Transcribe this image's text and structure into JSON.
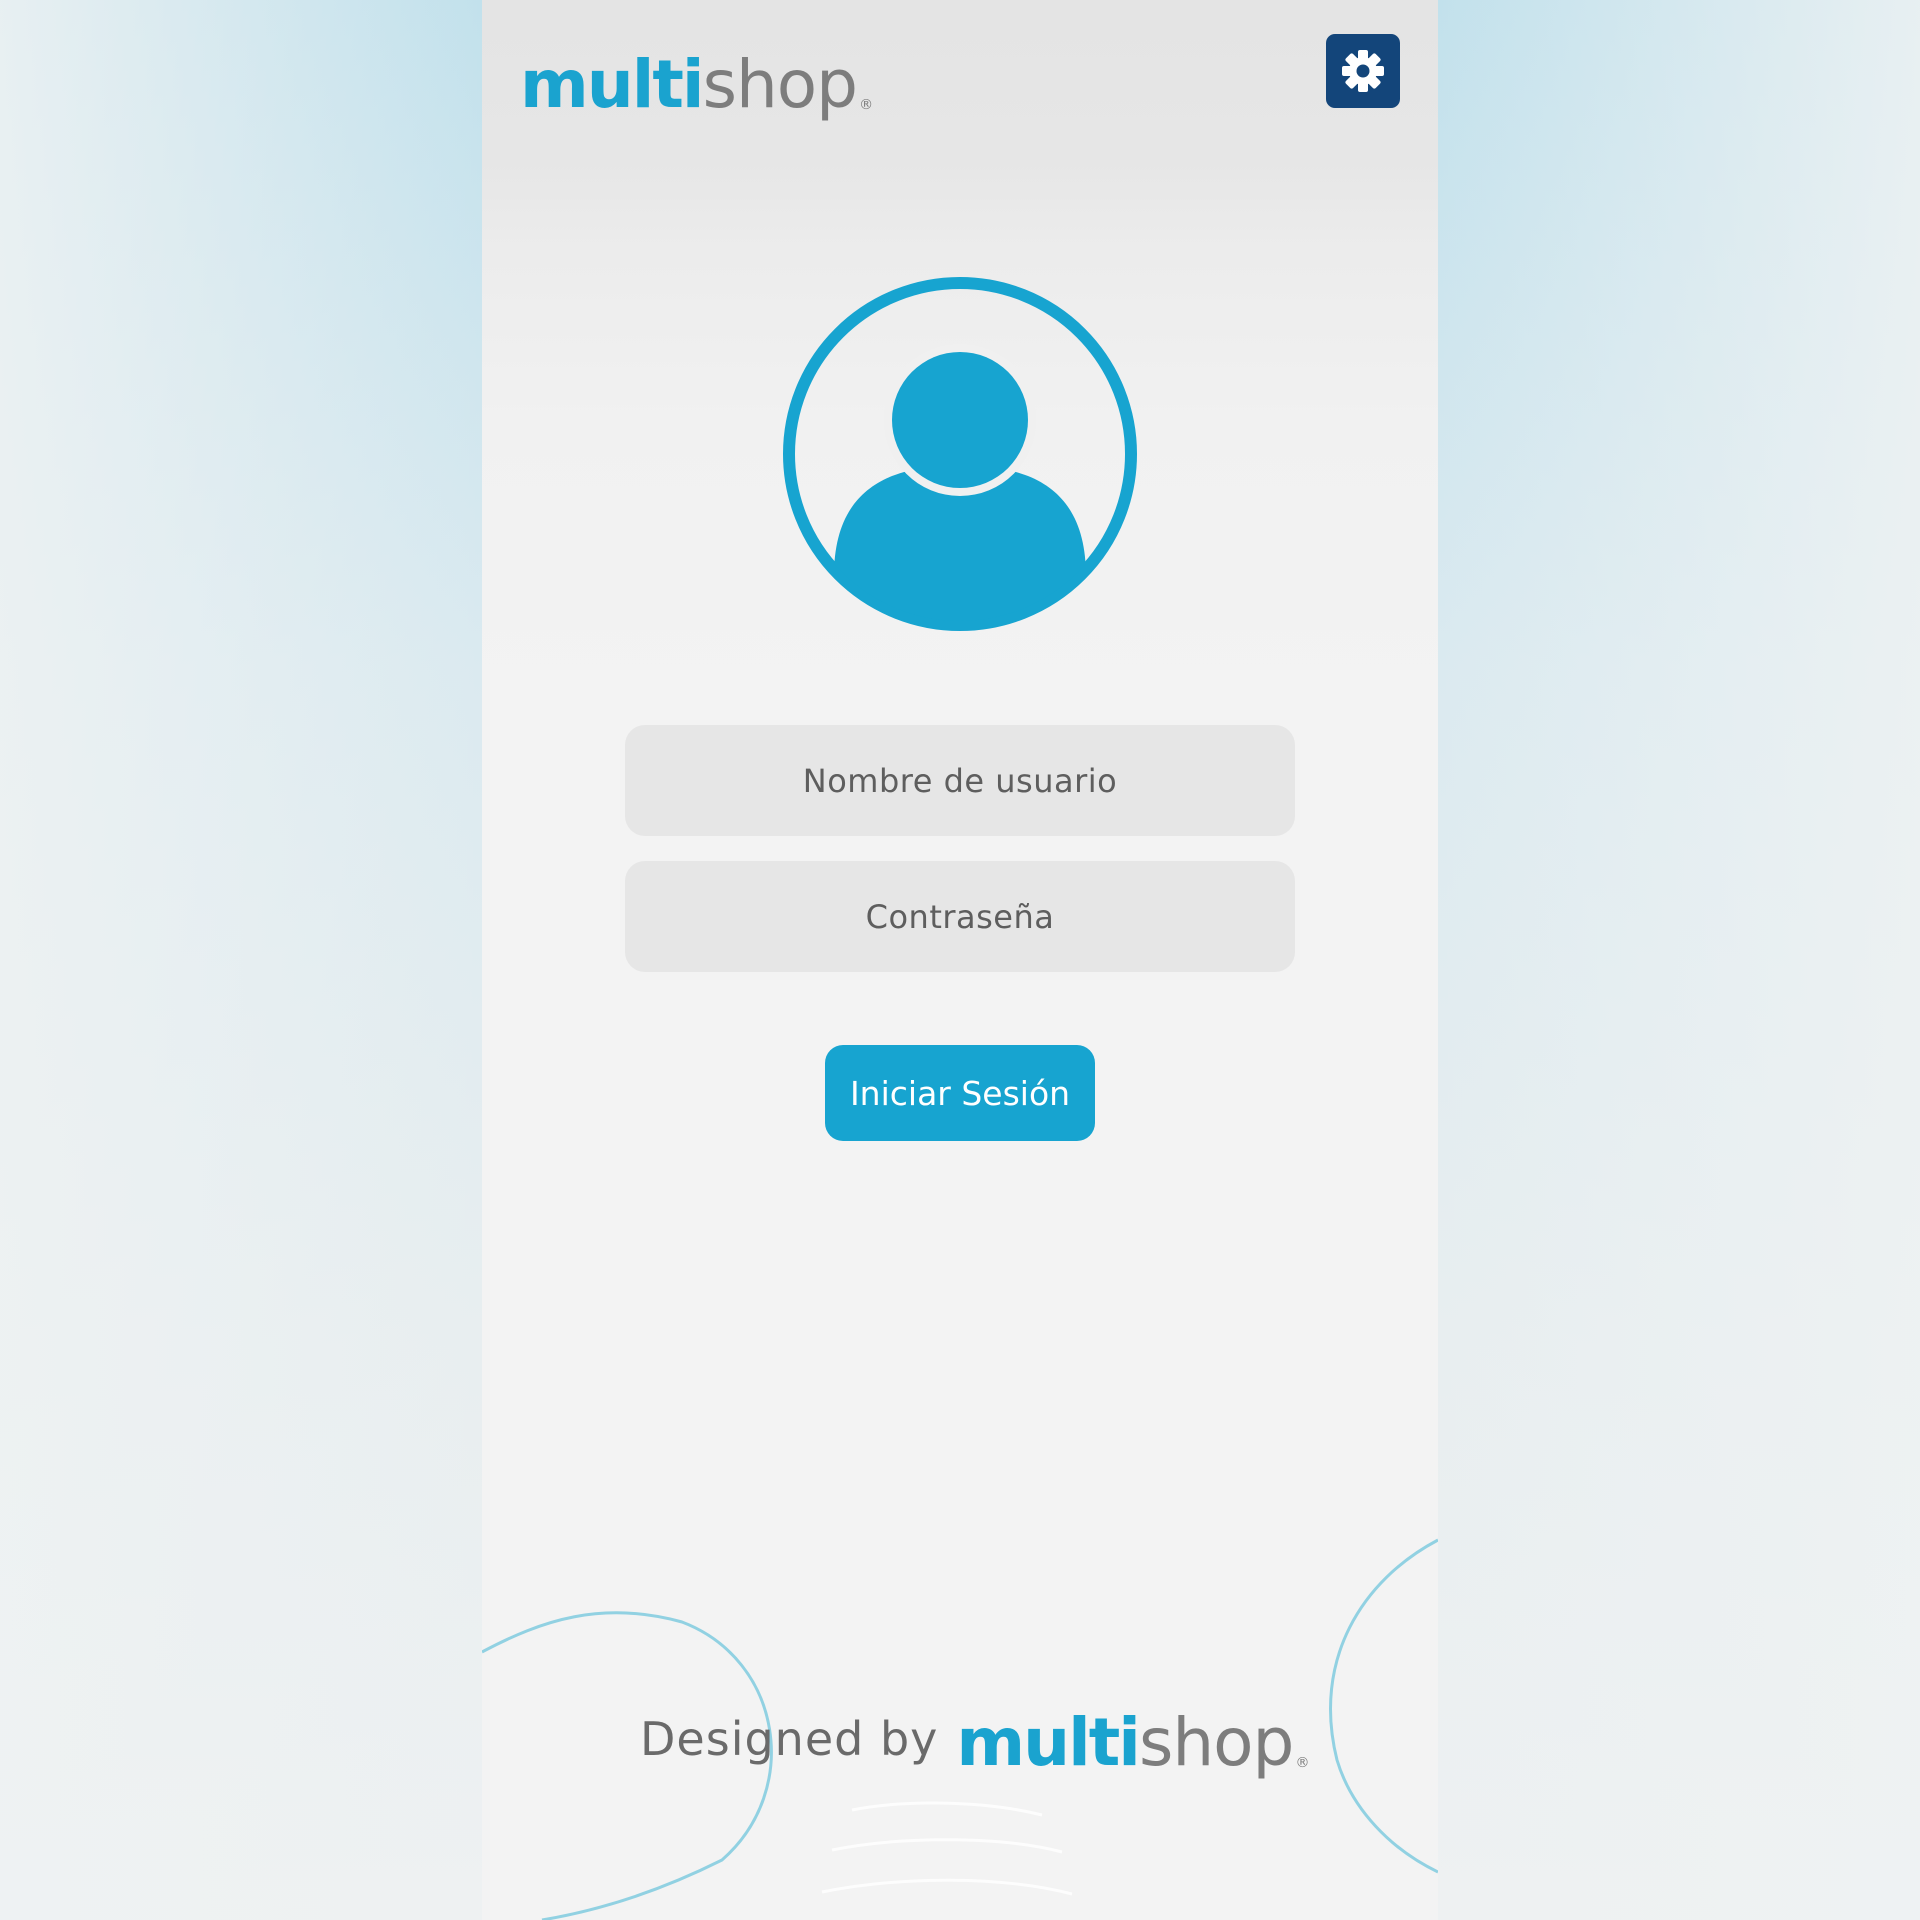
{
  "header": {
    "logo_bold": "multi",
    "logo_light": "shop",
    "logo_mark": "®",
    "settings_icon": "gear-icon"
  },
  "avatar": {
    "icon": "user-avatar-icon"
  },
  "form": {
    "username_placeholder": "Nombre de usuario",
    "password_placeholder": "Contraseña",
    "login_label": "Iniciar Sesión"
  },
  "footer": {
    "prefix": "Designed by",
    "logo_bold": "multi",
    "logo_light": "shop",
    "logo_mark": "®"
  },
  "colors": {
    "brand_blue": "#17a4d0",
    "settings_bg": "#13457a",
    "field_bg": "#e6e6e6",
    "text_gray": "#5e5e5e"
  }
}
